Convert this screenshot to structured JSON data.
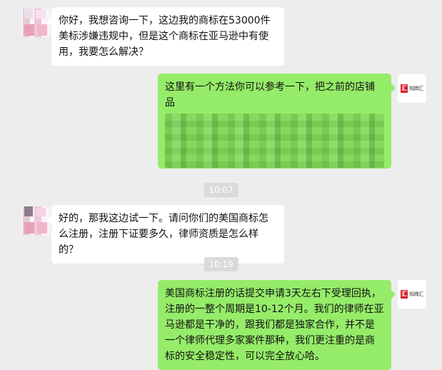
{
  "messages": [
    {
      "sender": "customer",
      "text": "你好，我想咨询一下，这边我的商标在53000件美标涉嫌违规中，但是这个商标在亚马逊中有使用，我要怎么解决？"
    },
    {
      "sender": "agent",
      "text": "这里有一个方法你可以参考一下，把之前的店铺品",
      "has_redacted_content": true
    },
    {
      "timestamp": "10:07"
    },
    {
      "sender": "customer",
      "text": "好的，那我这边试一下。请问你们的美国商标怎么注册，注册下证要多久，律师资质是怎么样的？"
    },
    {
      "timestamp": "10:19"
    },
    {
      "sender": "agent",
      "text": "美国商标注册的话提交申请3天左右下受理回执，注册的一整个周期是10-12个月。我们的律师在亚马逊都是干净的，跟我们都是独家合作，并不是一个律师代理多家案件那种，我们更注重的是商标的安全稳定性，可以完全放心哈。"
    }
  ],
  "agent_logo_text": "知商汇",
  "colors": {
    "background": "#ededed",
    "self_bubble": "#95ec69",
    "other_bubble": "#ffffff",
    "logo_red": "#d8202a"
  }
}
